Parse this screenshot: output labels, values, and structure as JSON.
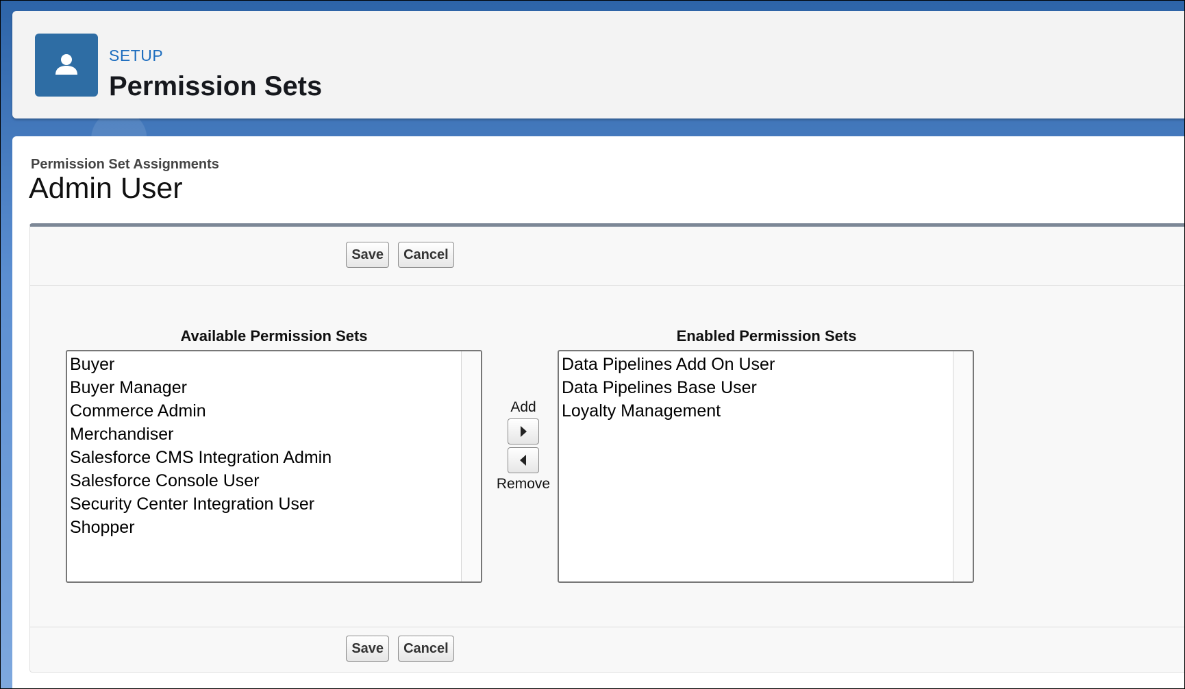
{
  "header": {
    "eyebrow": "SETUP",
    "title": "Permission Sets",
    "icon": "user-icon"
  },
  "page": {
    "subtitle": "Permission Set Assignments",
    "title": "Admin User"
  },
  "buttons": {
    "save": "Save",
    "cancel": "Cancel"
  },
  "available": {
    "label": "Available Permission Sets",
    "items": [
      "Buyer",
      "Buyer Manager",
      "Commerce Admin",
      "Merchandiser",
      "Salesforce CMS Integration Admin",
      "Salesforce Console User",
      "Security Center Integration User",
      "Shopper"
    ]
  },
  "enabled": {
    "label": "Enabled Permission Sets",
    "items": [
      "Data Pipelines Add On User",
      "Data Pipelines Base User",
      "Loyalty Management"
    ]
  },
  "mover": {
    "add_label": "Add",
    "remove_label": "Remove"
  },
  "colors": {
    "header_icon_bg": "#2e6da4",
    "eyebrow": "#1b6cbe"
  }
}
